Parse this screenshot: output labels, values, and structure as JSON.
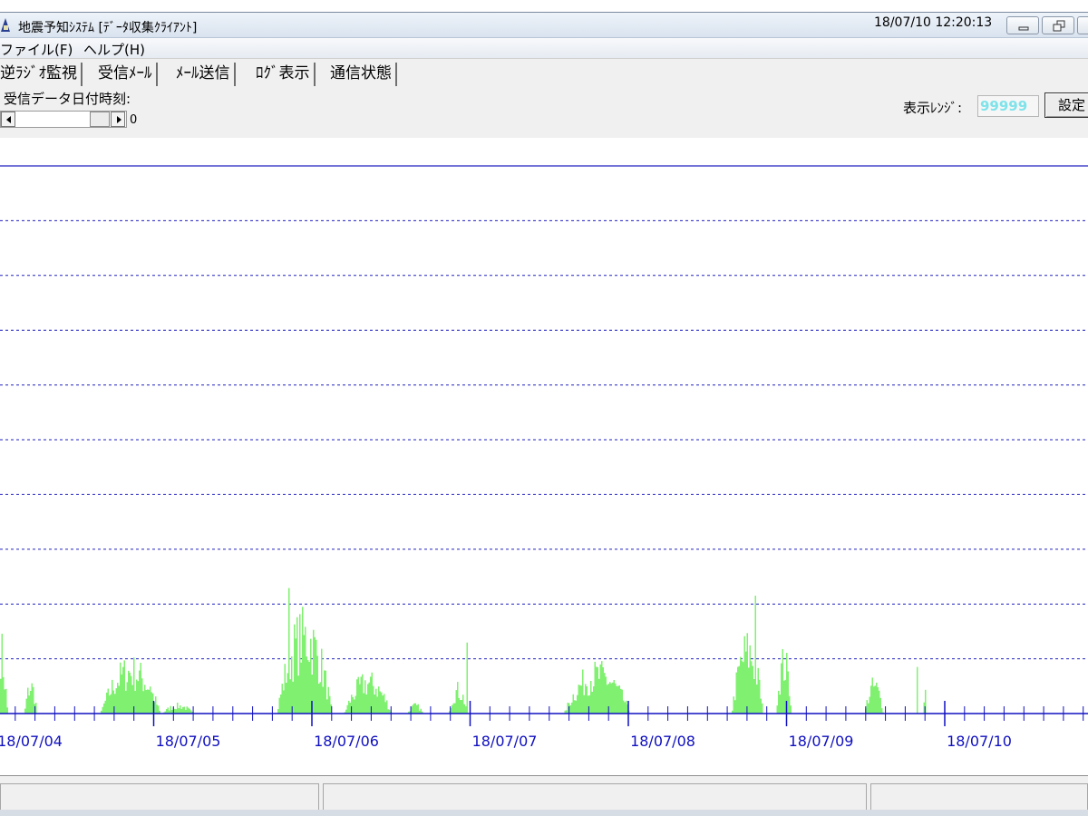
{
  "window": {
    "title": "地震予知ｼｽﾃﾑ [ﾃﾞｰﾀ収集ｸﾗｲｱﾝﾄ]"
  },
  "menu": {
    "items": [
      "ファイル(F)",
      "ヘルプ(H)"
    ]
  },
  "tabs": [
    {
      "label": "逆ﾗｼﾞｵ監視",
      "active": true
    },
    {
      "label": "受信ﾒｰﾙ",
      "active": false
    },
    {
      "label": "ﾒｰﾙ送信",
      "active": false
    },
    {
      "label": "ﾛｸﾞ表示",
      "active": false
    },
    {
      "label": "通信状態",
      "active": false
    }
  ],
  "controls": {
    "date_label": "受信データ日付時刻:",
    "scroll_value": "0",
    "range_label": "表示ﾚﾝｼﾞ:",
    "range_value": "99999",
    "set_button": "設定"
  },
  "chart_data": {
    "type": "bar",
    "x_tick_labels": [
      "18/07/04",
      "18/07/05",
      "18/07/06",
      "18/07/07",
      "18/07/08",
      "18/07/09",
      "18/07/10"
    ],
    "bar_color": "#80f070",
    "grid_color": "#2020c0",
    "axis_color": "#1010c0",
    "ylim": [
      0,
      1
    ],
    "gridlines": 10,
    "grid_dashed": true,
    "bursts": [
      {
        "center_day": -0.05,
        "width_day": 0.25,
        "peak": 0.3
      },
      {
        "center_day": 0.0,
        "width_day": 0.02,
        "peak": 0.29
      },
      {
        "center_day": 0.22,
        "width_day": 0.08,
        "peak": 0.07
      },
      {
        "center_day": 0.85,
        "width_day": 0.38,
        "peak": 0.11
      },
      {
        "center_day": 0.97,
        "width_day": 0.01,
        "peak": 0.21
      },
      {
        "center_day": 1.15,
        "width_day": 0.2,
        "peak": 0.02
      },
      {
        "center_day": 1.95,
        "width_day": 0.35,
        "peak": 0.2
      },
      {
        "center_day": 1.85,
        "width_day": 0.01,
        "peak": 0.29
      },
      {
        "center_day": 2.02,
        "width_day": 0.01,
        "peak": 0.28
      },
      {
        "center_day": 2.35,
        "width_day": 0.3,
        "peak": 0.08
      },
      {
        "center_day": 2.65,
        "width_day": 0.1,
        "peak": 0.02
      },
      {
        "center_day": 2.92,
        "width_day": 0.12,
        "peak": 0.06
      },
      {
        "center_day": 2.98,
        "width_day": 0.01,
        "peak": 0.25
      },
      {
        "center_day": 3.8,
        "width_day": 0.42,
        "peak": 0.1
      },
      {
        "center_day": 4.75,
        "width_day": 0.2,
        "peak": 0.16
      },
      {
        "center_day": 4.8,
        "width_day": 0.01,
        "peak": 0.23
      },
      {
        "center_day": 4.98,
        "width_day": 0.1,
        "peak": 0.13
      },
      {
        "center_day": 5.55,
        "width_day": 0.12,
        "peak": 0.07
      },
      {
        "center_day": 5.82,
        "width_day": 0.01,
        "peak": 0.22
      },
      {
        "center_day": 5.87,
        "width_day": 0.01,
        "peak": 0.22
      }
    ]
  },
  "status": {
    "timestamp": "18/07/10 12:20:13"
  }
}
